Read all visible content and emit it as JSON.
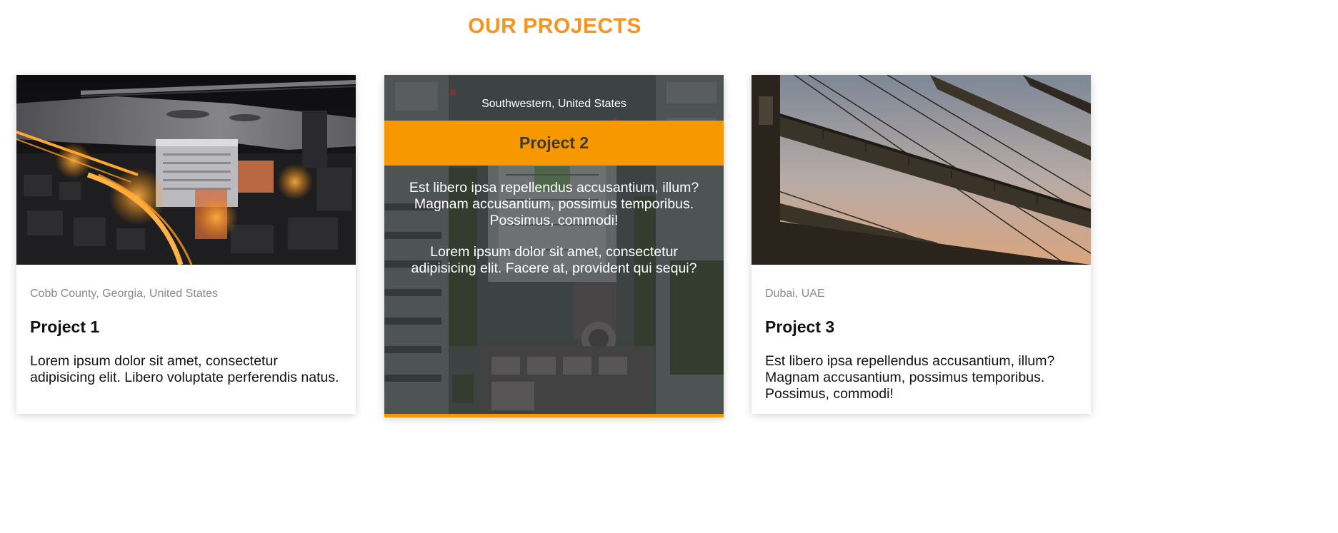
{
  "section": {
    "title": "OUR PROJECTS",
    "accent_color": "#f7931e"
  },
  "projects": [
    {
      "location": "Cobb County, Georgia, United States",
      "title": "Project 1",
      "description": "Lorem ipsum dolor sit amet, consectetur adipisicing elit. Libero voluptate perferendis natus.",
      "image": "night-city-aerial-photo"
    },
    {
      "location": "Southwestern, United States",
      "title": "Project 2",
      "paragraphs": [
        "Est libero ipsa repellendus accusantium, illum? Magnam accusantium, possimus temporibus. Possimus, commodi!",
        "Lorem ipsum dolor sit amet, consectetur adipisicing elit. Facere at, provident qui sequi?"
      ],
      "image": "aerial-city-photo",
      "state": "hovered",
      "band_color": "#f89800"
    },
    {
      "location": "Dubai, UAE",
      "title": "Project 3",
      "description": "Est libero ipsa repellendus accusantium, illum? Magnam accusantium, possimus temporibus. Possimus, commodi!",
      "image": "crane-silhouette-photo"
    }
  ]
}
